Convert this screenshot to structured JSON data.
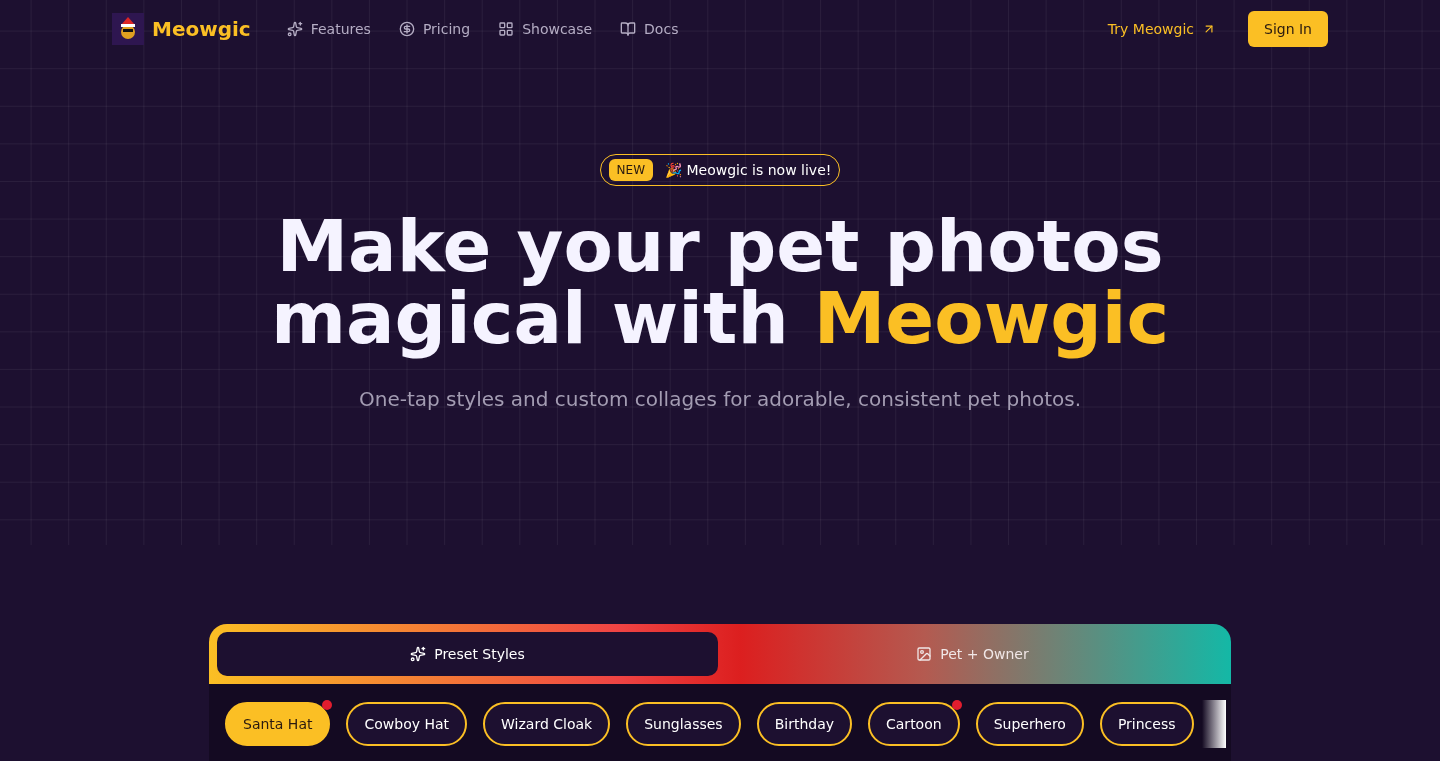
{
  "nav": {
    "brand": "Meowgic",
    "links": [
      {
        "label": "Features"
      },
      {
        "label": "Pricing"
      },
      {
        "label": "Showcase"
      },
      {
        "label": "Docs"
      }
    ],
    "try_link": "Try Meowgic",
    "sign_in": "Sign In"
  },
  "hero": {
    "badge": "NEW",
    "announcement": "🎉 Meowgic is now live!",
    "title_line1": "Make your pet photos",
    "title_line2": "magical with ",
    "title_highlight": "Meowgic",
    "subtitle": "One-tap styles and custom collages for adorable, consistent pet photos."
  },
  "tabs": [
    {
      "label": "Preset Styles",
      "selected": true
    },
    {
      "label": "Pet + Owner",
      "selected": false
    }
  ],
  "styles": [
    {
      "label": "Santa Hat",
      "selected": true,
      "dot": true
    },
    {
      "label": "Cowboy Hat",
      "selected": false,
      "dot": false
    },
    {
      "label": "Wizard Cloak",
      "selected": false,
      "dot": false
    },
    {
      "label": "Sunglasses",
      "selected": false,
      "dot": false
    },
    {
      "label": "Birthday",
      "selected": false,
      "dot": false
    },
    {
      "label": "Cartoon",
      "selected": false,
      "dot": true
    },
    {
      "label": "Superhero",
      "selected": false,
      "dot": false
    },
    {
      "label": "Princess",
      "selected": false,
      "dot": false
    }
  ]
}
